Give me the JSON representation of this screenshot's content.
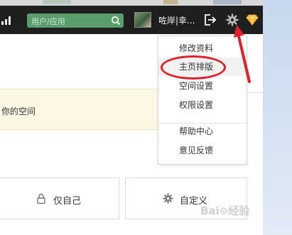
{
  "header": {
    "search_placeholder": "用户/应用",
    "username": "咗岸|幸...",
    "icons": [
      "bar-chart-icon",
      "search-icon",
      "logout-icon",
      "gear-icon",
      "vip-diamond-icon"
    ]
  },
  "menu": {
    "items": [
      "修改资料",
      "主页排版",
      "空间设置",
      "权限设置"
    ],
    "items2": [
      "帮助中心",
      "意见反馈"
    ],
    "highlighted": "主页排版"
  },
  "notice": {
    "text": "你的空间"
  },
  "options": {
    "private_label": "仅自己",
    "custom_label": "自定义"
  },
  "watermark": "Bai⊙经验",
  "colors": {
    "header_bg": "#1e1e1e",
    "search_bg": "#5a9e6e",
    "annotation_red": "#e0202a",
    "notice_bg": "#fdf8e4"
  }
}
